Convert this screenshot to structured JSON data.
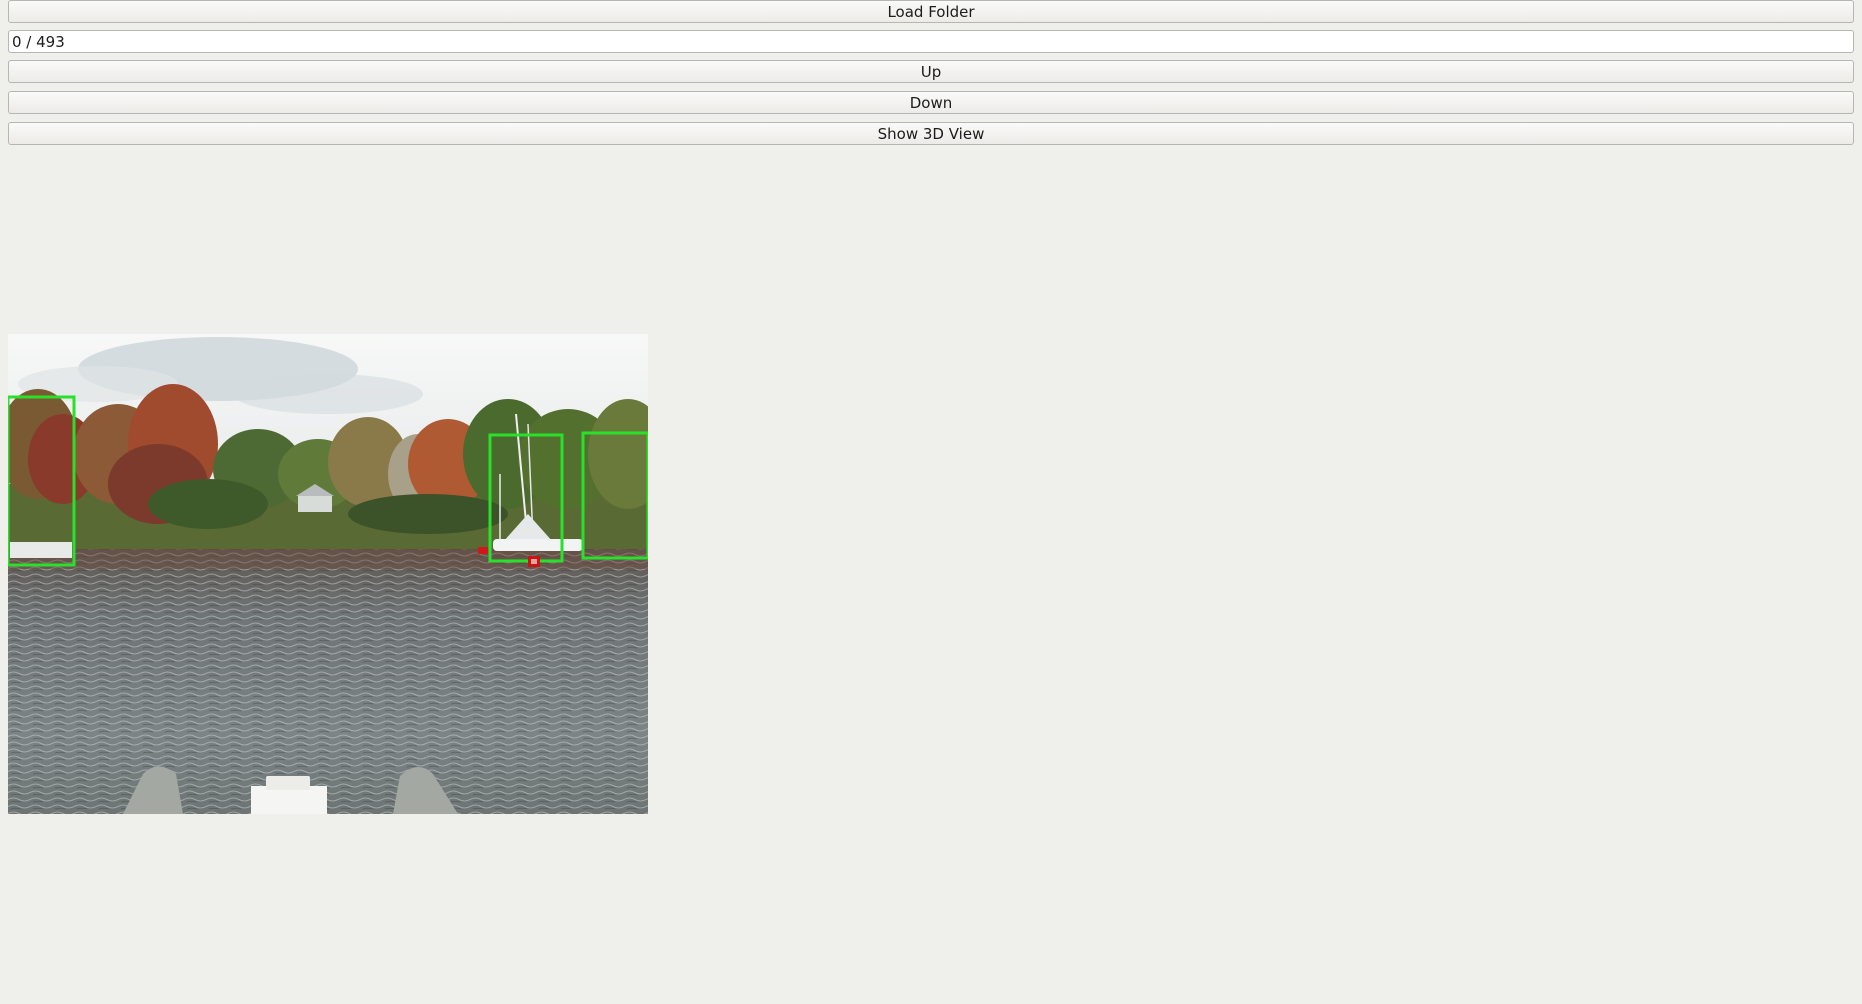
{
  "controls": {
    "load_folder_label": "Load Folder",
    "counter_text": "0 / 493",
    "up_label": "Up",
    "down_label": "Down",
    "show_3d_label": "Show 3D View"
  },
  "colors": {
    "background": "#efefec",
    "detection_box": "#29e02b",
    "marker": "#d01818"
  }
}
